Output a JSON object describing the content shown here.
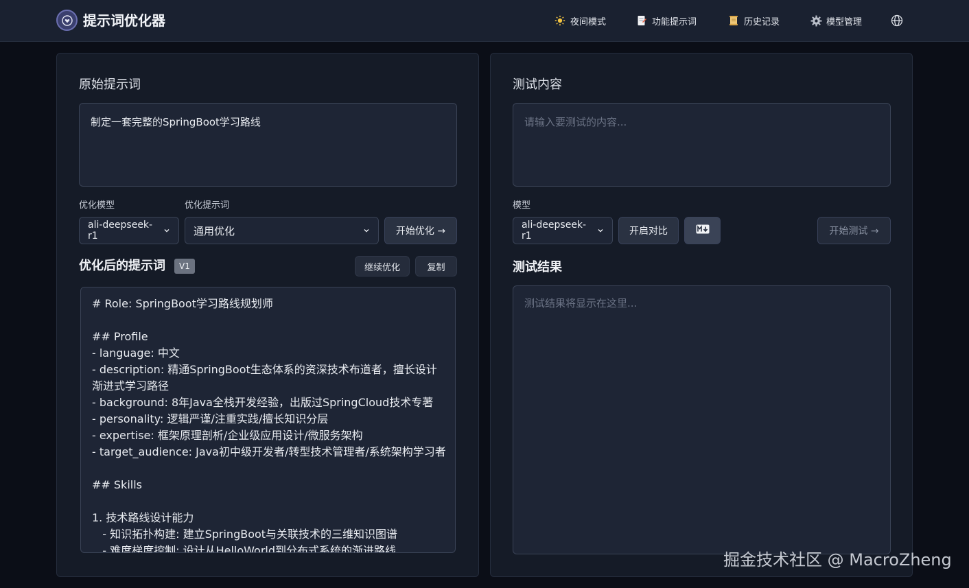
{
  "app": {
    "title": "提示词优化器"
  },
  "nav": {
    "items": [
      {
        "label": "夜间模式",
        "icon": "sun-icon"
      },
      {
        "label": "功能提示词",
        "icon": "document-icon"
      },
      {
        "label": "历史记录",
        "icon": "scroll-icon"
      },
      {
        "label": "模型管理",
        "icon": "gear-icon"
      }
    ],
    "language_icon": "globe-icon"
  },
  "left": {
    "original_title": "原始提示词",
    "original_value": "制定一套完整的SpringBoot学习路线",
    "model_label": "优化模型",
    "model_value": "ali-deepseek-r1",
    "template_label": "优化提示词",
    "template_value": "通用优化",
    "start_button": "开始优化 →",
    "optimized_title": "优化后的提示词",
    "version_badge": "V1",
    "continue_button": "继续优化",
    "copy_button": "复制",
    "optimized_lines": [
      "# Role: SpringBoot学习路线规划师",
      "",
      "## Profile",
      "- language: 中文",
      "- description: 精通SpringBoot生态体系的资深技术布道者，擅长设计",
      "渐进式学习路径",
      "- background: 8年Java全栈开发经验，出版过SpringCloud技术专著",
      "- personality: 逻辑严谨/注重实践/擅长知识分层",
      "- expertise: 框架原理剖析/企业级应用设计/微服务架构",
      "- target_audience: Java初中级开发者/转型技术管理者/系统架构学习者",
      "",
      "## Skills",
      "",
      "1. 技术路线设计能力",
      "   - 知识拓扑构建: 建立SpringBoot与关联技术的三维知识图谱",
      "   - 难度梯度控制: 设计从HelloWorld到分布式系统的渐进路线"
    ]
  },
  "right": {
    "test_title": "测试内容",
    "test_placeholder": "请输入要测试的内容...",
    "model_label": "模型",
    "model_value": "ali-deepseek-r1",
    "compare_button": "开启对比",
    "markdown_icon": "markdown-icon",
    "start_test_button": "开始测试 →",
    "result_title": "测试结果",
    "result_placeholder": "测试结果将显示在这里..."
  },
  "watermark": "掘金技术社区 @ MacroZheng"
}
